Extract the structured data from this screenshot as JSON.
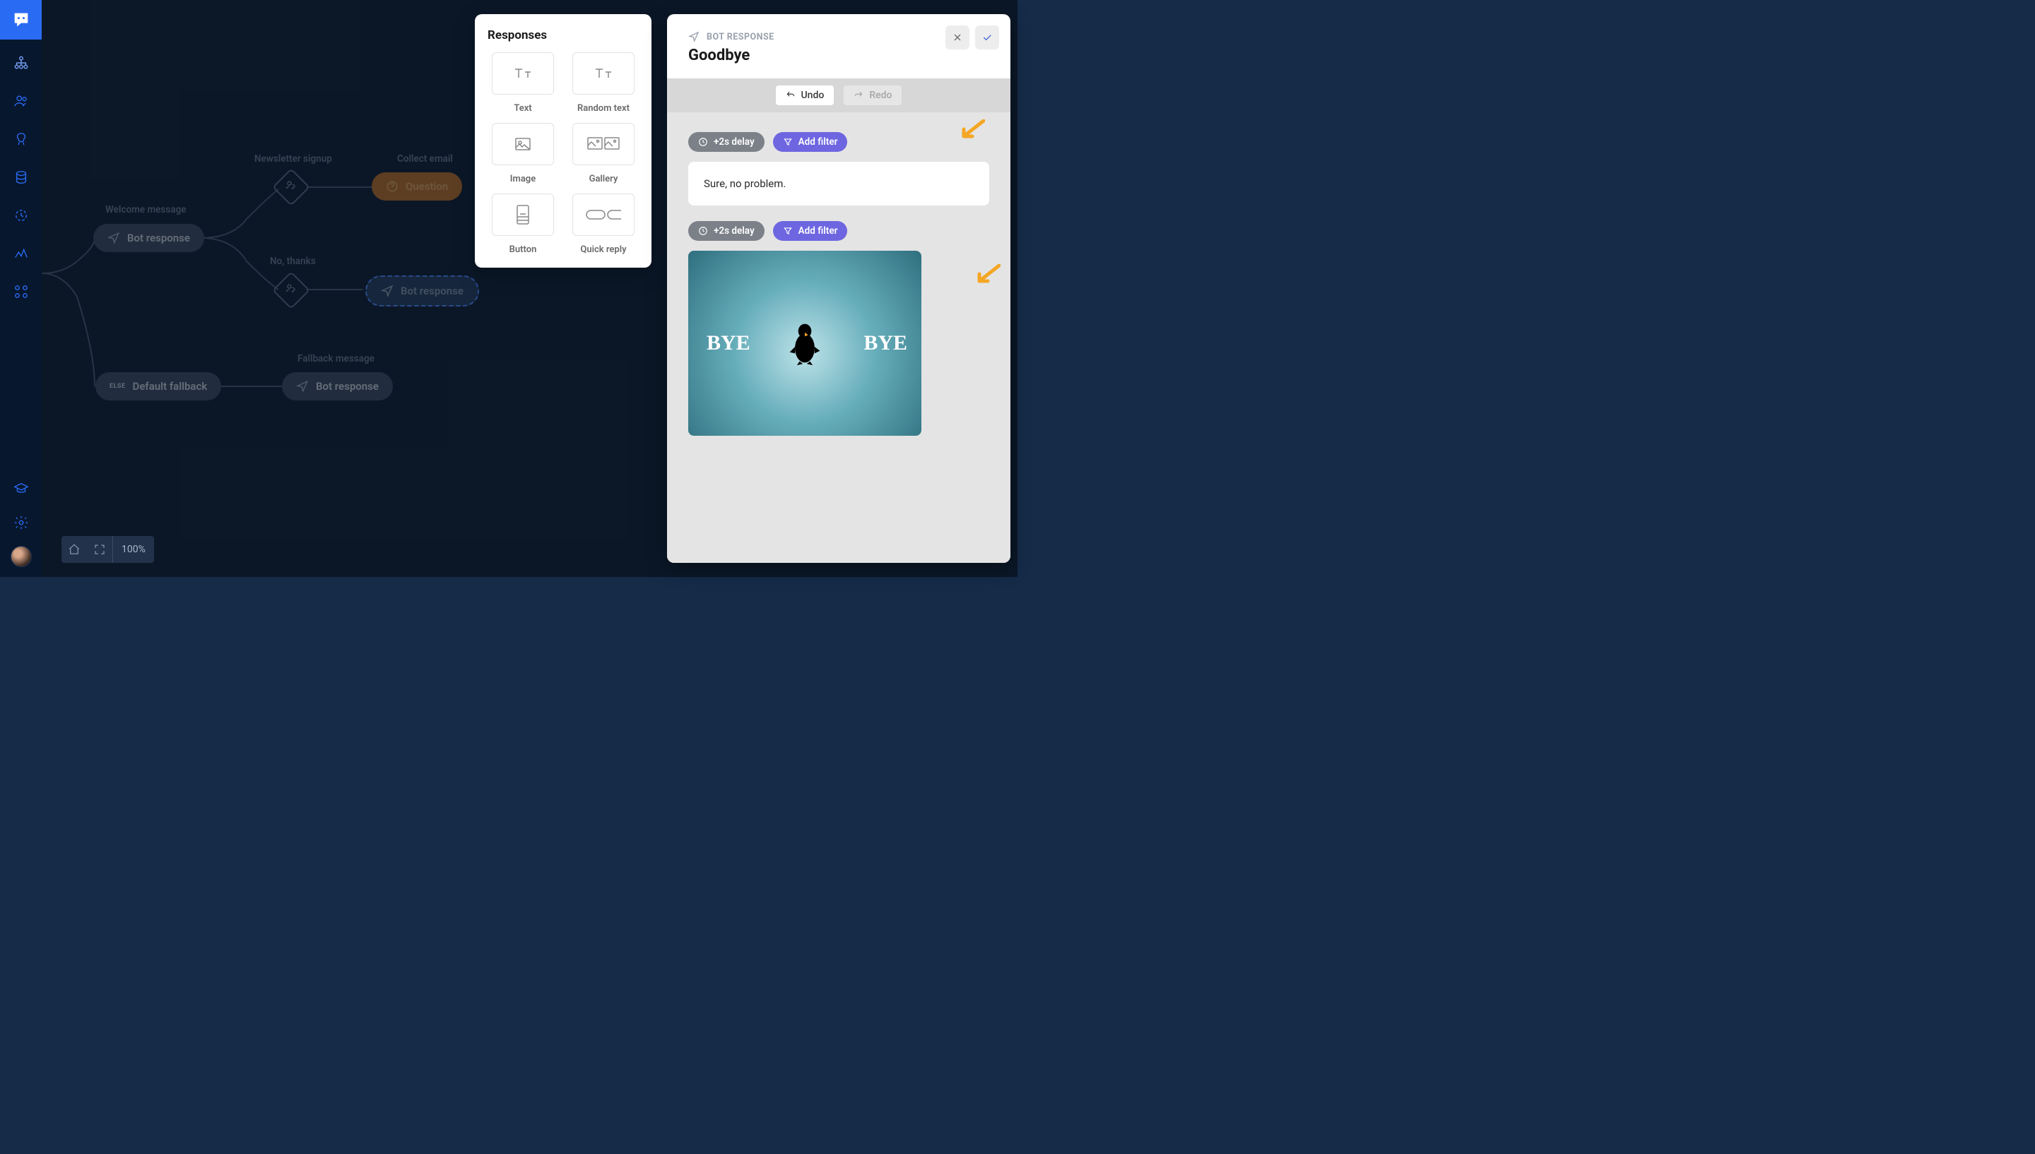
{
  "sidebar": {
    "items": [
      {
        "id": "builder"
      },
      {
        "id": "users"
      },
      {
        "id": "ai"
      },
      {
        "id": "database"
      },
      {
        "id": "history"
      },
      {
        "id": "analytics"
      },
      {
        "id": "integrations"
      }
    ],
    "bottom": [
      {
        "id": "academy"
      },
      {
        "id": "settings"
      }
    ]
  },
  "zoom": {
    "label": "100%"
  },
  "canvas": {
    "labels": {
      "welcome": "Welcome message",
      "newsletter": "Newsletter signup",
      "collect_email": "Collect email",
      "no_thanks": "No, thanks",
      "fallback": "Fallback message"
    },
    "nodes": {
      "bot_response": "Bot response",
      "question": "Question",
      "default_fallback": "Default fallback",
      "else": "ELSE"
    }
  },
  "responses_panel": {
    "title": "Responses",
    "items": [
      {
        "id": "text",
        "label": "Text"
      },
      {
        "id": "random_text",
        "label": "Random text"
      },
      {
        "id": "image",
        "label": "Image"
      },
      {
        "id": "gallery",
        "label": "Gallery"
      },
      {
        "id": "button",
        "label": "Button"
      },
      {
        "id": "quick_reply",
        "label": "Quick reply"
      }
    ]
  },
  "editor": {
    "type_label": "BOT RESPONSE",
    "title": "Goodbye",
    "undo": "Undo",
    "redo": "Redo",
    "delay": "+2s delay",
    "add_filter": "Add filter",
    "text_message": "Sure, no problem.",
    "image_bye_left": "BYE",
    "image_bye_right": "BYE"
  }
}
